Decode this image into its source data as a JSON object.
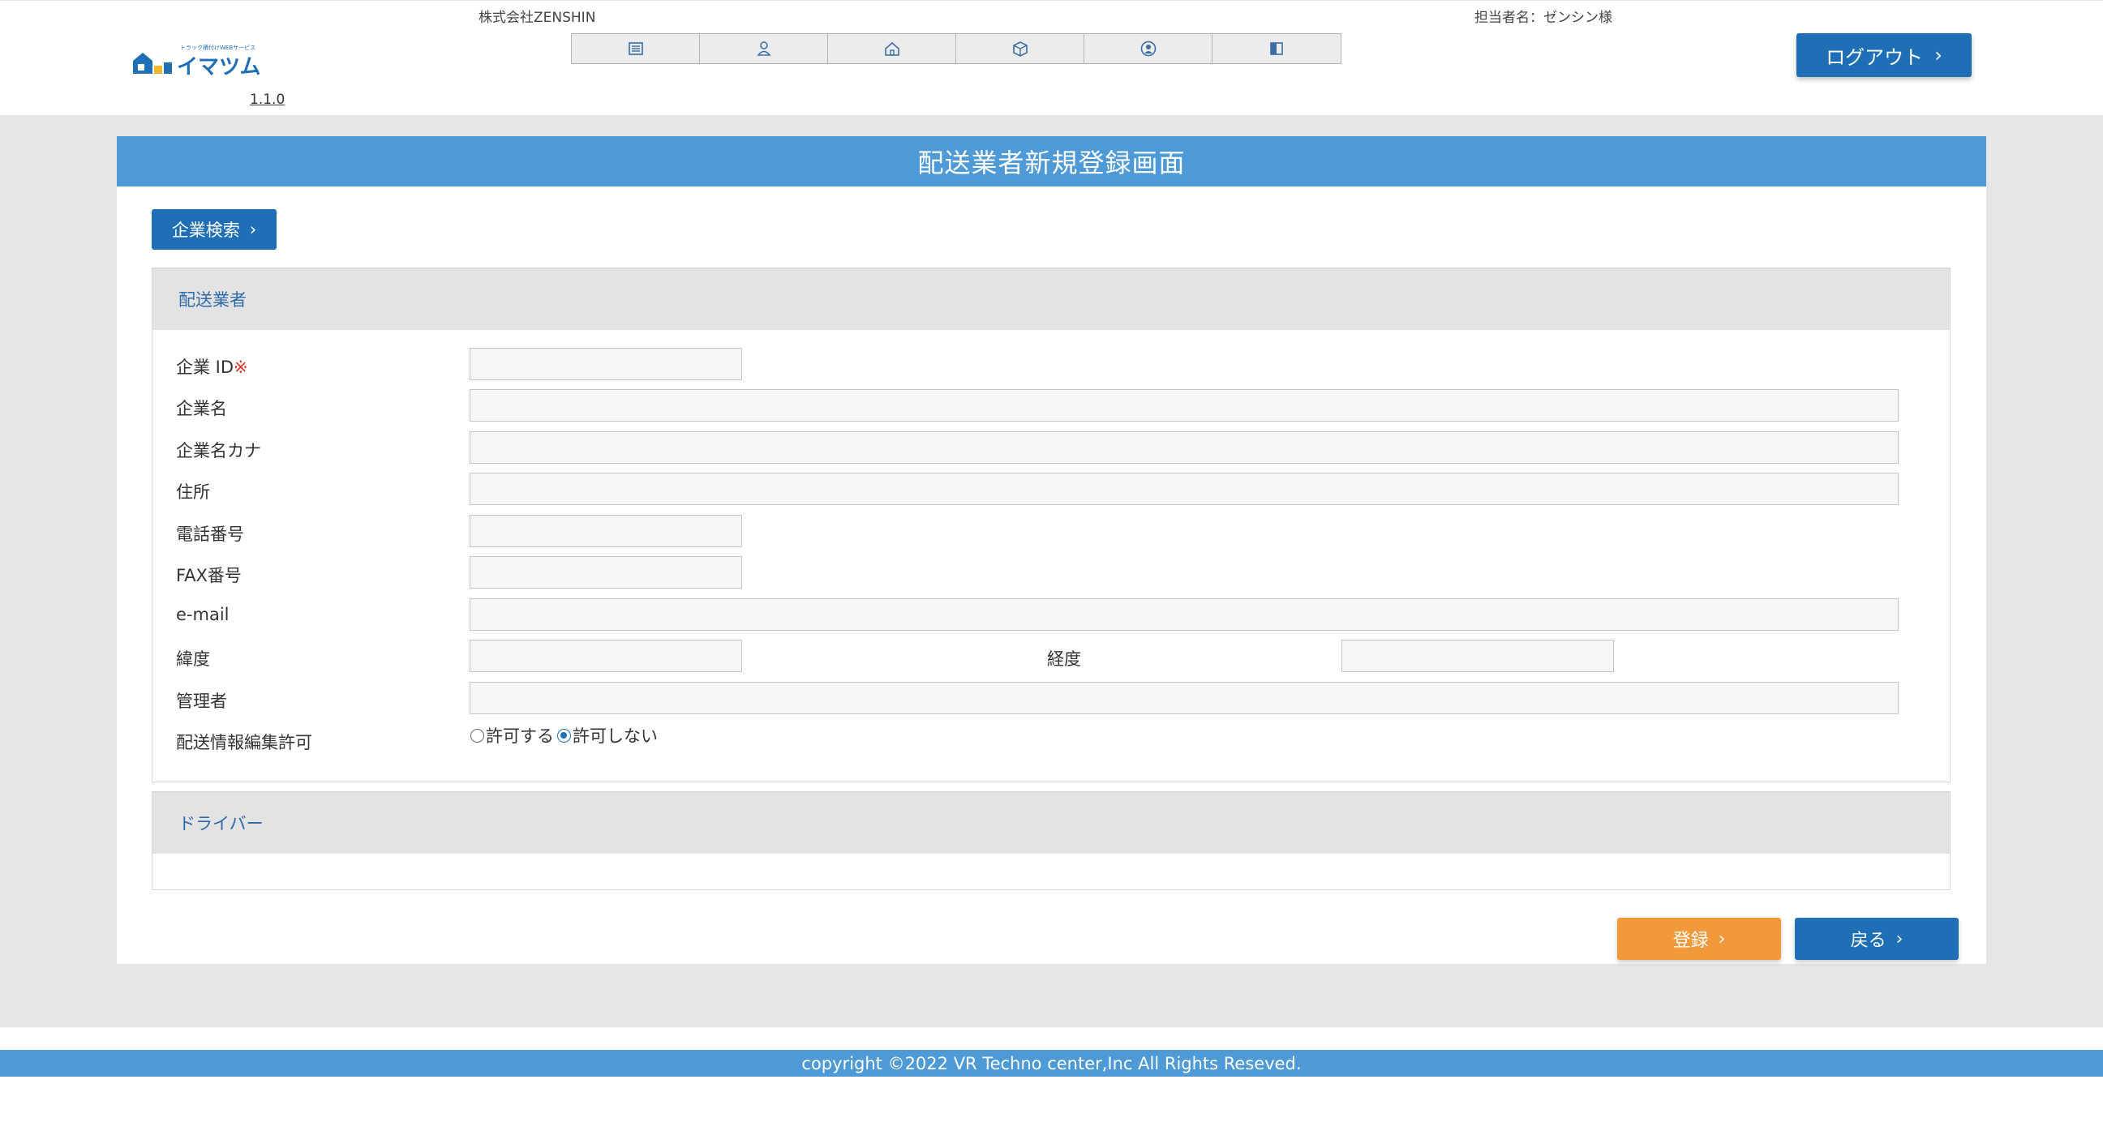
{
  "header": {
    "company": "株式会社ZENSHIN",
    "user": "担当者名：ゼンシン様",
    "version": "1.1.0",
    "logo_text": "イマツム",
    "logout_label": "ログアウト"
  },
  "nav": {
    "icons": [
      "list-icon",
      "person-icon",
      "home-icon",
      "box-icon",
      "user-circle-icon",
      "book-icon"
    ]
  },
  "page": {
    "title": "配送業者新規登録画面",
    "search_button": "企業検索"
  },
  "carrier_panel": {
    "heading": "配送業者",
    "fields": {
      "company_id": "企業 ID",
      "required_mark": "※",
      "company_name": "企業名",
      "company_kana": "企業名カナ",
      "address": "住所",
      "phone": "電話番号",
      "fax": "FAX番号",
      "email": "e-mail",
      "latitude": "緯度",
      "longitude": "経度",
      "manager": "管理者",
      "edit_permission": "配送情報編集許可"
    },
    "values": {
      "company_id": "",
      "company_name": "",
      "company_kana": "",
      "address": "",
      "phone": "",
      "fax": "",
      "email": "",
      "latitude": "",
      "longitude": "",
      "manager": ""
    },
    "permission_options": [
      {
        "label": "許可する",
        "checked": false
      },
      {
        "label": "許可しない",
        "checked": true
      }
    ]
  },
  "driver_panel": {
    "heading": "ドライバー"
  },
  "actions": {
    "register": "登録",
    "back": "戻る"
  },
  "footer": {
    "copyright": "copyright ©2022 VR Techno center,Inc All Rights Reseved."
  },
  "colors": {
    "primary": "#1f6fb7",
    "title_bar": "#4d9ad6",
    "accent_orange": "#f29a3b",
    "required": "#d9342b"
  }
}
